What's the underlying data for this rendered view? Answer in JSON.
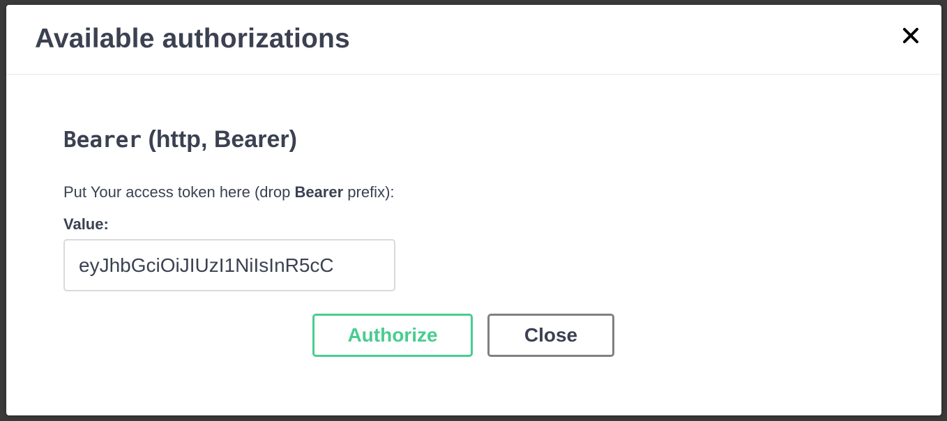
{
  "modal": {
    "title": "Available authorizations",
    "close_icon": "close-x-icon"
  },
  "scheme": {
    "name": "Bearer",
    "type_info": "(http, Bearer)",
    "description_prefix": "Put Your access token here (drop ",
    "description_bold": "Bearer",
    "description_suffix": " prefix):",
    "value_label": "Value:",
    "value": "eyJhbGciOiJIUzI1NiIsInR5cC"
  },
  "buttons": {
    "authorize_label": "Authorize",
    "close_label": "Close"
  },
  "colors": {
    "authorize_accent": "#49cc90",
    "close_border": "#808080",
    "text": "#3b4151"
  }
}
